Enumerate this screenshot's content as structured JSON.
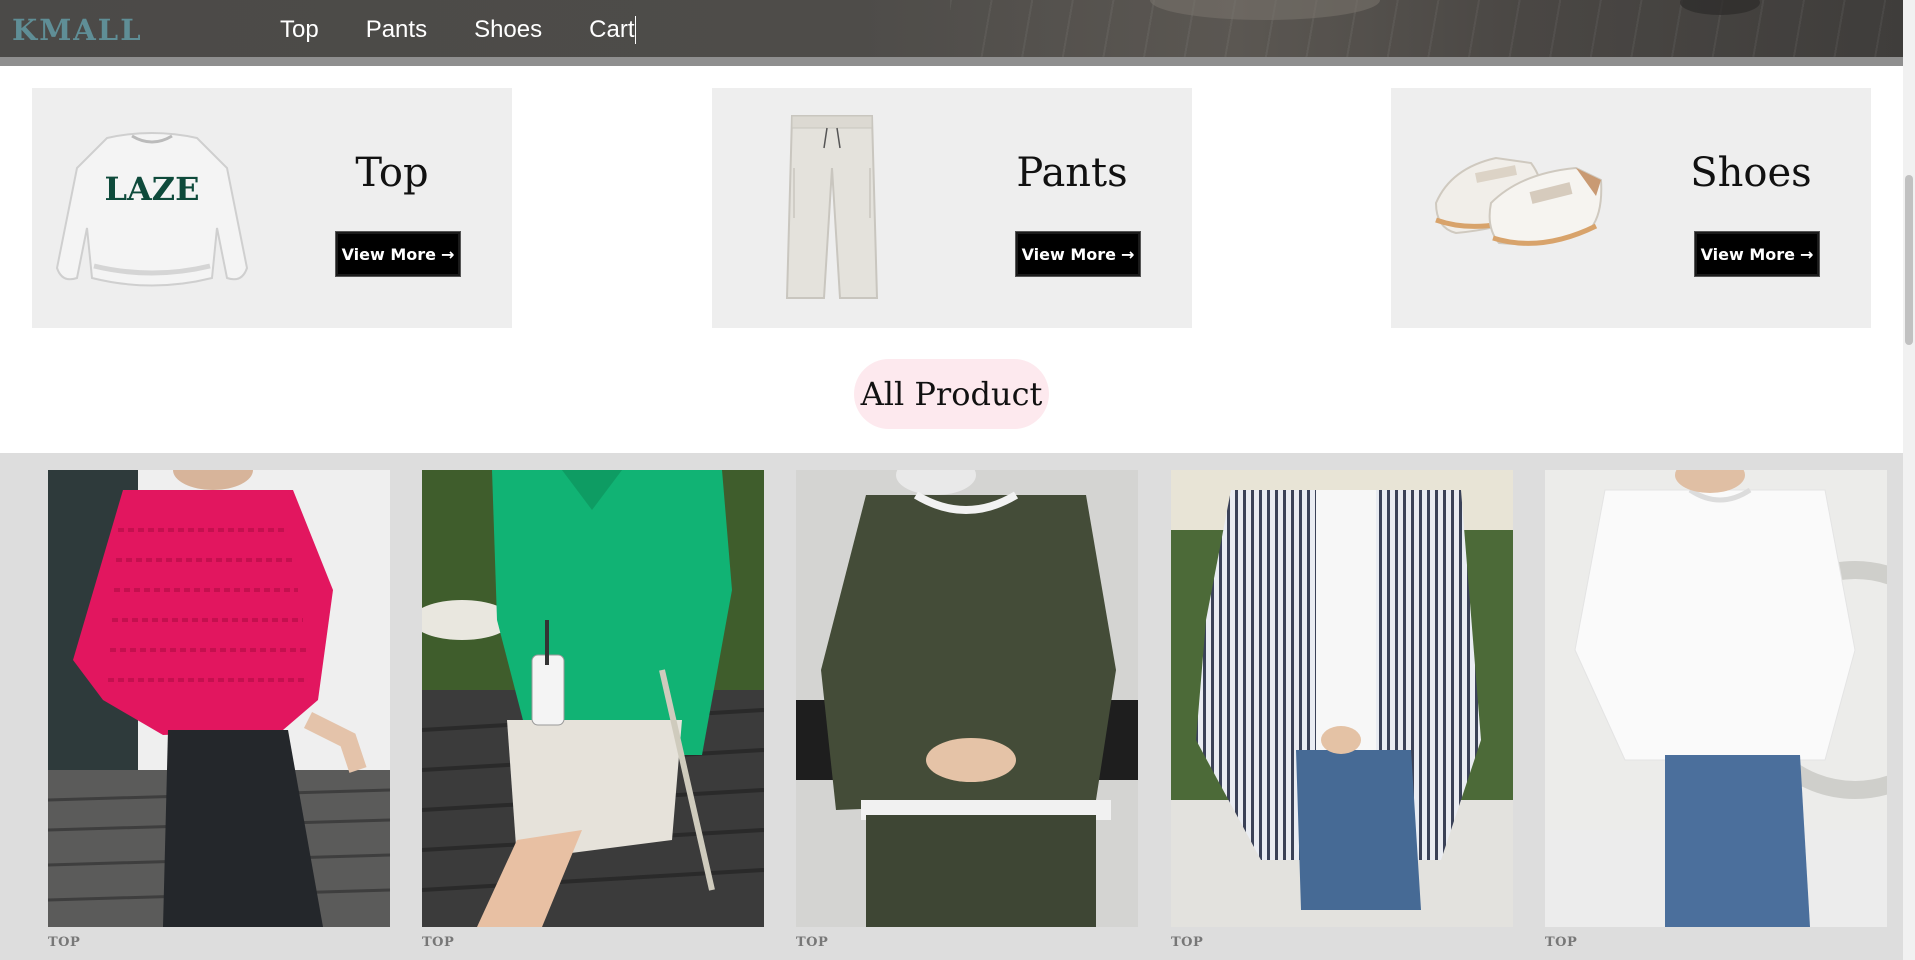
{
  "header": {
    "logo": "KMALL",
    "nav": [
      "Top",
      "Pants",
      "Shoes",
      "Cart"
    ]
  },
  "categories": [
    {
      "title": "Top",
      "button": "View More",
      "image": "sweatshirt-image"
    },
    {
      "title": "Pants",
      "button": "View More",
      "image": "pants-image"
    },
    {
      "title": "Shoes",
      "button": "View More",
      "image": "sneakers-image"
    }
  ],
  "section": {
    "title": "All Product"
  },
  "products": [
    {
      "category": "TOP",
      "image": "pink-knit-tee-photo"
    },
    {
      "category": "TOP",
      "image": "green-polo-knit-photo"
    },
    {
      "category": "TOP",
      "image": "olive-sweatshirt-photo"
    },
    {
      "category": "TOP",
      "image": "striped-shirt-photo"
    },
    {
      "category": "TOP",
      "image": "white-tee-photo"
    }
  ],
  "colors": {
    "header_bg": "#4b4a48",
    "logo": "#5f8e96",
    "card_bg": "#eeeeee",
    "button_bg": "#000000",
    "section_pill": "#fde9ee",
    "grid_bg": "#dddddd"
  }
}
